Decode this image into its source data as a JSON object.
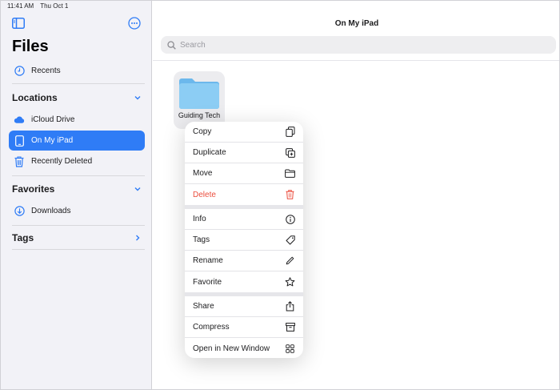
{
  "status_bar": {
    "time": "11:41 AM",
    "date": "Thu Oct 1"
  },
  "sidebar": {
    "title": "Files",
    "recents": {
      "label": "Recents",
      "icon": "clock-icon"
    },
    "sections": {
      "locations": {
        "label": "Locations"
      },
      "favorites": {
        "label": "Favorites"
      },
      "tags": {
        "label": "Tags"
      }
    },
    "locations": [
      {
        "label": "iCloud Drive",
        "icon": "cloud-icon"
      },
      {
        "label": "On My iPad",
        "icon": "ipad-icon",
        "selected": true
      },
      {
        "label": "Recently Deleted",
        "icon": "trash-icon"
      }
    ],
    "favorites": [
      {
        "label": "Downloads",
        "icon": "download-icon"
      }
    ]
  },
  "main": {
    "title": "On My iPad",
    "search": {
      "placeholder": "Search"
    },
    "folder": {
      "name": "Guiding Tech"
    }
  },
  "context_menu": {
    "group1": [
      {
        "label": "Copy",
        "icon": "copy-icon"
      },
      {
        "label": "Duplicate",
        "icon": "duplicate-icon"
      },
      {
        "label": "Move",
        "icon": "folder-icon"
      },
      {
        "label": "Delete",
        "icon": "trash-icon",
        "destructive": true
      }
    ],
    "group2": [
      {
        "label": "Info",
        "icon": "info-icon"
      },
      {
        "label": "Tags",
        "icon": "tag-icon"
      },
      {
        "label": "Rename",
        "icon": "pencil-icon"
      },
      {
        "label": "Favorite",
        "icon": "star-icon"
      }
    ],
    "group3": [
      {
        "label": "Share",
        "icon": "share-icon"
      },
      {
        "label": "Compress",
        "icon": "archive-icon"
      },
      {
        "label": "Open in New Window",
        "icon": "new-window-icon"
      }
    ]
  },
  "colors": {
    "accent": "#2f7cf6",
    "destructive": "#eb4d3d",
    "sidebar_bg": "#f2f2f7",
    "folder": "#7cc4f1"
  }
}
